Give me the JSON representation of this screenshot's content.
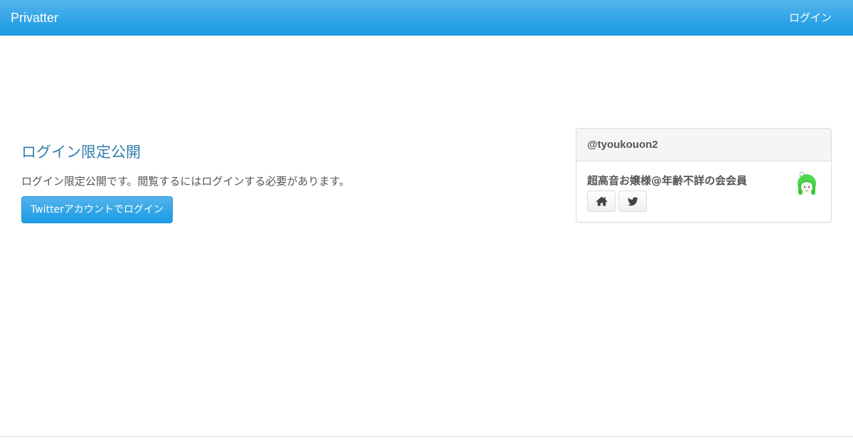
{
  "navbar": {
    "brand": "Privatter",
    "login_link": "ログイン",
    "color": "#2fa4e7"
  },
  "main": {
    "heading": "ログイン限定公開",
    "description": "ログイン限定公開です。閲覧するにはログインする必要があります。",
    "twitter_login_button": "Twitterアカウントでログイン"
  },
  "profile_panel": {
    "handle": "@tyoukouon2",
    "display_name": "超高音お嬢様@年齢不詳の会会員",
    "icons": [
      "home-icon",
      "twitter-icon"
    ],
    "avatar": "avatar-green-hair-character"
  }
}
